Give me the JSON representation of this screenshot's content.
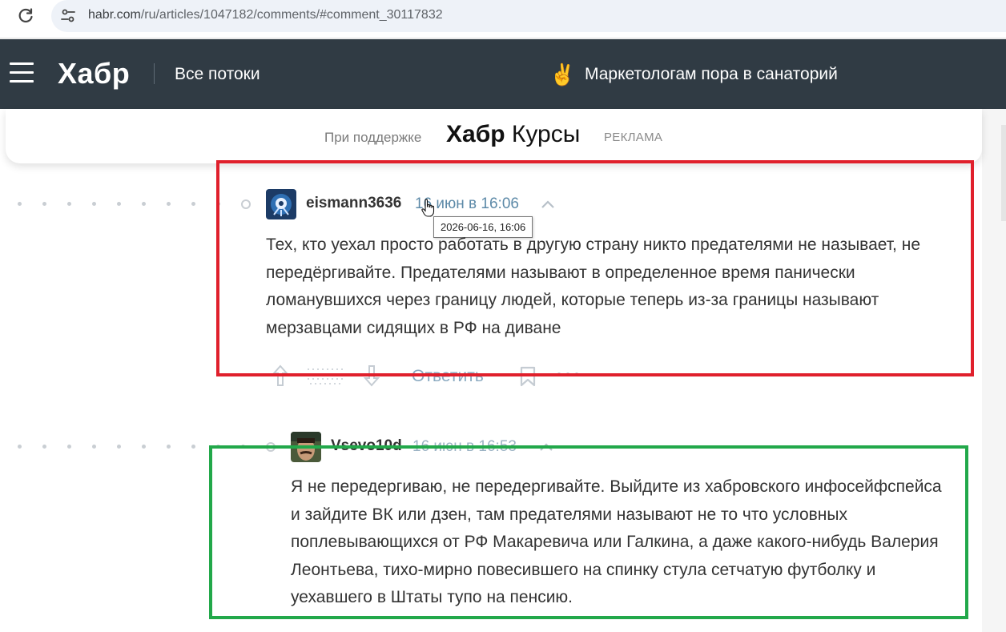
{
  "browser": {
    "url_host": "habr.com",
    "url_path": "/ru/articles/1047182/comments/#comment_30117832"
  },
  "header": {
    "logo": "Хабр",
    "all_streams": "Все потоки",
    "promo_emoji": "✌️",
    "promo_text": "Маркетологам пора в санаторий"
  },
  "sponsor": {
    "label": "При поддержке",
    "brand_bold": "Хабр",
    "brand_rest": " Курсы",
    "ad": "РЕКЛАМА"
  },
  "comments": [
    {
      "username": "eismann3636",
      "time": "16 июн в 16:06",
      "tooltip": "2026-06-16, 16:06",
      "body": "Тех, кто уехал просто работать в другую страну никто предателями не называет, не передёргивайте. Предателями называют в определенное время панически ломанувшихся через границу людей, которые теперь из-за границы называют мерзавцами сидящих в РФ на диване",
      "reply_label": "Ответить"
    },
    {
      "username": "Vsevo10d",
      "time": "16 июн в 16:53",
      "body": "Я не передергиваю, не передергивайте. Выйдите из хабровского инфосейфспейса и зайдите ВК или дзен, там предателями называют не то что условных поплевывающихся от РФ Макаревича или Галкина, а даже какого-нибудь Валерия Леонтьева, тихо-мирно повесившего на спинку стула сетчатую футболку и уехавшего в Штаты тупо на пенсию."
    }
  ],
  "colors": {
    "header_bg": "#303b44",
    "link": "#5d8aa8",
    "highlight_red": "#e0202c",
    "highlight_green": "#22a84a"
  }
}
